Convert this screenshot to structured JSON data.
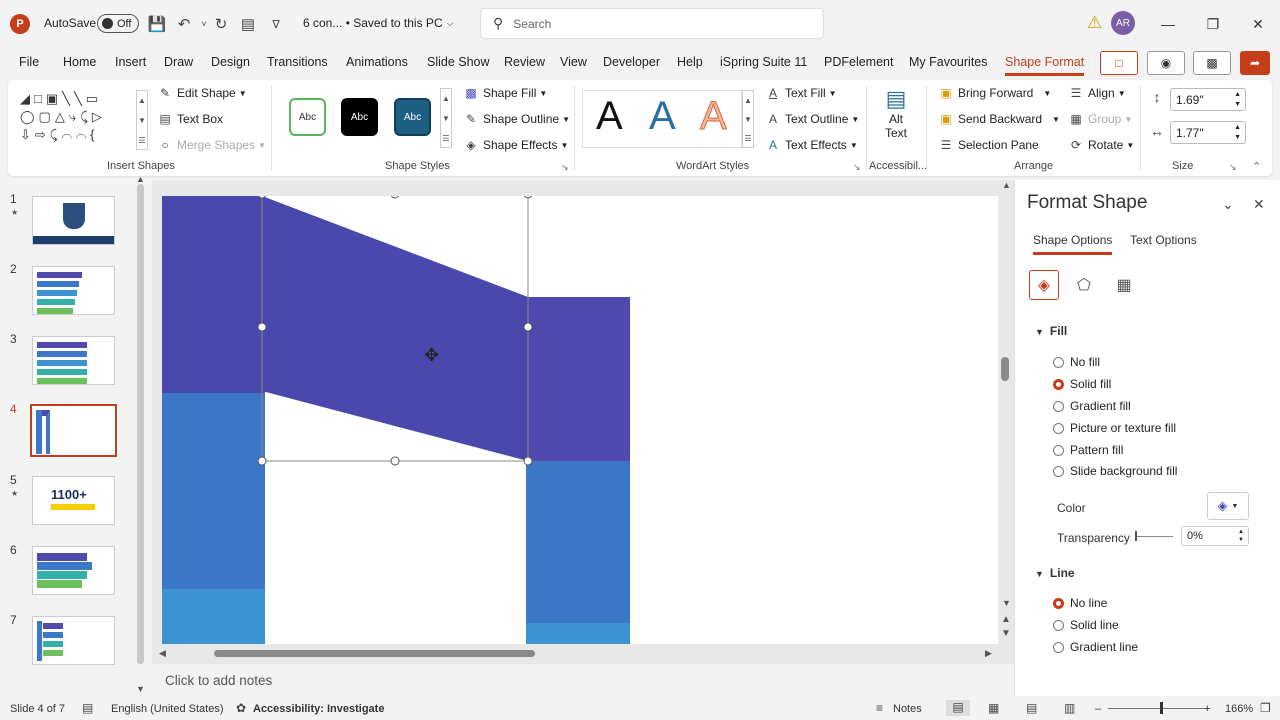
{
  "titlebar": {
    "autosave_label": "AutoSave",
    "autosave_state": "Off",
    "doc_title": "6 con... • Saved to this PC",
    "search_placeholder": "Search",
    "user_initials": "AR",
    "app_icon": "powerpoint-icon"
  },
  "tabs": [
    "File",
    "Home",
    "Insert",
    "Draw",
    "Design",
    "Transitions",
    "Animations",
    "Slide Show",
    "Review",
    "View",
    "Developer",
    "Help",
    "iSpring Suite 11",
    "PDFelement",
    "My Favourites",
    "Shape Format"
  ],
  "active_tab": "Shape Format",
  "ribbon": {
    "insert_shapes": {
      "edit_shape": "Edit Shape",
      "text_box": "Text Box",
      "merge_shapes": "Merge Shapes",
      "label": "Insert Shapes"
    },
    "shape_styles": {
      "samples": [
        "Abc",
        "Abc",
        "Abc"
      ],
      "shape_fill": "Shape Fill",
      "shape_outline": "Shape Outline",
      "shape_effects": "Shape Effects",
      "label": "Shape Styles"
    },
    "wordart": {
      "samples": [
        "A",
        "A",
        "A"
      ],
      "text_fill": "Text Fill",
      "text_outline": "Text Outline",
      "text_effects": "Text Effects",
      "label": "WordArt Styles"
    },
    "accessibility": {
      "alt_text_1": "Alt",
      "alt_text_2": "Text",
      "label": "Accessibil..."
    },
    "arrange": {
      "bring_forward": "Bring Forward",
      "send_backward": "Send Backward",
      "selection_pane": "Selection Pane",
      "align": "Align",
      "group": "Group",
      "rotate": "Rotate",
      "label": "Arrange"
    },
    "size": {
      "height": "1.69\"",
      "width": "1.77\"",
      "label": "Size"
    }
  },
  "slides": [
    {
      "num": "1",
      "star": true
    },
    {
      "num": "2",
      "star": false
    },
    {
      "num": "3",
      "star": false
    },
    {
      "num": "4",
      "star": false
    },
    {
      "num": "5",
      "star": true
    },
    {
      "num": "6",
      "star": false
    },
    {
      "num": "7",
      "star": false
    }
  ],
  "active_slide": 4,
  "thumb5_text": "1100+",
  "notes_placeholder": "Click to add notes",
  "format_pane": {
    "title": "Format Shape",
    "tab_shape": "Shape Options",
    "tab_text": "Text Options",
    "fill_head": "Fill",
    "fill_options": [
      "No fill",
      "Solid fill",
      "Gradient fill",
      "Picture or texture fill",
      "Pattern fill",
      "Slide background fill"
    ],
    "fill_selected": "Solid fill",
    "color_label": "Color",
    "transparency_label": "Transparency",
    "transparency_value": "0%",
    "line_head": "Line",
    "line_options": [
      "No line",
      "Solid line",
      "Gradient line"
    ],
    "line_selected": "No line"
  },
  "status": {
    "slide_info": "Slide 4 of 7",
    "language": "English (United States)",
    "accessibility": "Accessibility: Investigate",
    "notes": "Notes",
    "zoom": "166%"
  },
  "colors": {
    "accent": "#c43e1c",
    "shape_purple": "#4a48ad",
    "shape_blue": "#3d77c8",
    "shape_light": "#3c93d0",
    "shape_mid": "#5049ae"
  }
}
